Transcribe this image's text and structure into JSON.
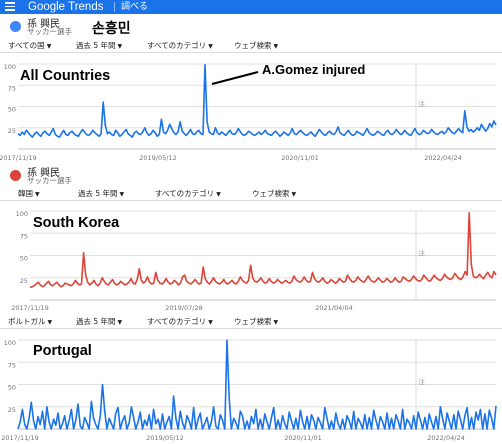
{
  "header": {
    "logo_google": "Google",
    "logo_trends": "Trends",
    "explore_label": "調べる"
  },
  "colors": {
    "blue": "#1a73e8",
    "red": "#db4437",
    "grid": "#e0e0e0"
  },
  "panels": [
    {
      "term": {
        "name": "孫 興民",
        "subtitle": "サッカー選手",
        "korean": "손흥민",
        "color": "#4285f4"
      },
      "filters": [
        "すべての国",
        "過去 5 年間",
        "すべてのカテゴリ",
        "ウェブ検索"
      ],
      "region_label": "All Countries",
      "annotation": "A.Gomez injured"
    },
    {
      "term": {
        "name": "孫 興民",
        "subtitle": "サッカー選手",
        "color": "#db4437"
      },
      "filters": [
        "韓国",
        "過去 5 年間",
        "すべてのカテゴリ",
        "ウェブ検索"
      ],
      "region_label": "South Korea"
    },
    {
      "filters": [
        "ポルトガル",
        "過去 5 年間",
        "すべてのカテゴリ",
        "ウェブ検索"
      ],
      "region_label": "Portugal"
    }
  ],
  "chart_data": [
    {
      "type": "line",
      "title": "All Countries",
      "ylim": [
        0,
        100
      ],
      "yticks": [
        25,
        50,
        75,
        100
      ],
      "x_ticks": [
        "2017/11/19",
        "2019/05/12",
        "2020/11/01",
        "2022/04/24"
      ],
      "note_label": "注",
      "grid": true,
      "series": [
        {
          "color": "#1a73e8",
          "values": [
            18,
            16,
            20,
            17,
            22,
            19,
            16,
            14,
            18,
            20,
            17,
            15,
            19,
            21,
            18,
            16,
            20,
            24,
            17,
            15,
            14,
            18,
            22,
            17,
            16,
            19,
            21,
            18,
            16,
            15,
            19,
            23,
            20,
            17,
            16,
            18,
            22,
            19,
            17,
            15,
            18,
            55,
            28,
            18,
            20,
            17,
            16,
            22,
            19,
            15,
            17,
            20,
            23,
            18,
            16,
            14,
            19,
            21,
            18,
            17,
            20,
            25,
            19,
            16,
            18,
            22,
            19,
            15,
            17,
            35,
            20,
            18,
            22,
            29,
            24,
            19,
            17,
            20,
            32,
            21,
            18,
            16,
            19,
            23,
            18,
            17,
            20,
            22,
            18,
            17,
            99,
            32,
            20,
            18,
            17,
            25,
            19,
            17,
            20,
            18,
            16,
            19,
            22,
            18,
            17,
            19,
            24,
            20,
            17,
            16,
            18,
            21,
            19,
            17,
            16,
            18,
            20,
            17,
            19,
            22,
            18,
            17,
            16,
            19,
            21,
            18,
            15,
            17,
            20,
            18,
            16,
            19,
            24,
            18,
            17,
            20,
            22,
            19,
            17,
            16,
            18,
            20,
            17,
            15,
            19,
            23,
            20,
            17,
            16,
            19,
            21,
            18,
            17,
            20,
            26,
            19,
            17,
            16,
            19,
            22,
            18,
            16,
            17,
            21,
            19,
            18,
            16,
            20,
            24,
            19,
            17,
            16,
            18,
            21,
            19,
            17,
            16,
            20,
            22,
            18,
            17,
            19,
            23,
            20,
            17,
            18,
            22,
            19,
            17,
            16,
            20,
            24,
            19,
            17,
            18,
            22,
            20,
            18,
            19,
            23,
            20,
            18,
            17,
            19,
            21,
            18,
            20,
            25,
            22,
            19,
            18,
            21,
            24,
            21,
            19,
            45,
            26,
            21,
            23,
            20,
            22,
            25,
            22,
            29,
            25,
            21,
            24,
            30,
            26,
            33,
            28
          ]
        }
      ]
    },
    {
      "type": "line",
      "title": "South Korea",
      "ylim": [
        0,
        100
      ],
      "yticks": [
        25,
        50,
        75,
        100
      ],
      "x_ticks": [
        "2017/11/19",
        "2019/07/28",
        "2021/04/04"
      ],
      "note_label": "注",
      "grid": true,
      "series": [
        {
          "color": "#db4437",
          "values": [
            14,
            15,
            16,
            18,
            20,
            17,
            15,
            16,
            19,
            21,
            17,
            16,
            18,
            20,
            17,
            15,
            16,
            19,
            18,
            17,
            16,
            18,
            22,
            19,
            17,
            18,
            53,
            28,
            20,
            17,
            19,
            22,
            18,
            16,
            19,
            25,
            21,
            18,
            17,
            20,
            23,
            19,
            17,
            18,
            21,
            19,
            17,
            18,
            20,
            24,
            19,
            18,
            23,
            35,
            22,
            19,
            21,
            26,
            20,
            18,
            19,
            31,
            22,
            19,
            18,
            20,
            24,
            20,
            18,
            19,
            22,
            20,
            17,
            19,
            26,
            28,
            21,
            19,
            18,
            20,
            23,
            20,
            18,
            19,
            37,
            24,
            20,
            18,
            21,
            25,
            21,
            19,
            18,
            20,
            23,
            19,
            18,
            20,
            22,
            19,
            18,
            21,
            26,
            22,
            20,
            19,
            22,
            39,
            25,
            21,
            20,
            22,
            25,
            21,
            19,
            20,
            24,
            21,
            19,
            20,
            23,
            21,
            19,
            20,
            22,
            20,
            19,
            21,
            27,
            23,
            21,
            20,
            22,
            26,
            22,
            20,
            21,
            31,
            24,
            21,
            20,
            22,
            25,
            21,
            19,
            20,
            23,
            21,
            19,
            20,
            24,
            22,
            20,
            21,
            28,
            24,
            21,
            20,
            22,
            26,
            23,
            21,
            20,
            23,
            27,
            23,
            21,
            20,
            22,
            25,
            22,
            20,
            21,
            24,
            22,
            20,
            21,
            25,
            22,
            20,
            21,
            26,
            24,
            22,
            21,
            23,
            27,
            24,
            22,
            21,
            23,
            28,
            25,
            22,
            21,
            24,
            28,
            25,
            23,
            22,
            24,
            29,
            26,
            24,
            23,
            25,
            30,
            27,
            24,
            23,
            26,
            32,
            28,
            98,
            40,
            27,
            25,
            26,
            29,
            26,
            24,
            28,
            31,
            27,
            25,
            32,
            28
          ]
        }
      ]
    },
    {
      "type": "line",
      "title": "Portugal",
      "ylim": [
        0,
        100
      ],
      "yticks": [
        25,
        50,
        75,
        100
      ],
      "x_ticks": [
        "2017/11/19",
        "2019/05/12",
        "2020/11/01",
        "2022/04/24"
      ],
      "note_label": "注",
      "grid": true,
      "series": [
        {
          "color": "#1a73e8",
          "values": [
            0,
            8,
            22,
            5,
            0,
            12,
            30,
            9,
            0,
            14,
            5,
            20,
            0,
            25,
            8,
            0,
            11,
            4,
            18,
            0,
            6,
            15,
            0,
            9,
            22,
            0,
            10,
            28,
            3,
            0,
            13,
            7,
            0,
            31,
            12,
            5,
            0,
            15,
            50,
            20,
            0,
            12,
            6,
            0,
            18,
            24,
            0,
            9,
            15,
            0,
            7,
            25,
            13,
            0,
            8,
            19,
            0,
            10,
            4,
            16,
            0,
            22,
            6,
            11,
            0,
            17,
            0,
            8,
            14,
            0,
            37,
            12,
            0,
            20,
            7,
            0,
            15,
            9,
            0,
            24,
            0,
            11,
            18,
            0,
            6,
            13,
            0,
            8,
            25,
            3,
            0,
            16,
            10,
            0,
            100,
            35,
            0,
            12,
            7,
            0,
            20,
            15,
            0,
            9,
            0,
            14,
            6,
            22,
            0,
            11,
            0,
            17,
            8,
            0,
            13,
            24,
            0,
            10,
            0,
            15,
            6,
            0,
            19,
            9,
            0,
            12,
            0,
            21,
            8,
            0,
            14,
            0,
            16,
            10,
            0,
            13,
            7,
            0,
            24,
            12,
            0,
            9,
            0,
            18,
            6,
            0,
            11,
            0,
            15,
            9,
            0,
            20,
            0,
            12,
            7,
            0,
            16,
            0,
            13,
            0,
            21,
            10,
            0,
            14,
            8,
            0,
            18,
            0,
            12,
            0,
            16,
            9,
            0,
            22,
            0,
            11,
            7,
            0,
            15,
            0,
            19,
            10,
            0,
            13,
            0,
            17,
            8,
            0,
            14,
            0,
            25,
            12,
            0,
            18,
            9,
            0,
            16,
            0,
            20,
            11,
            0,
            15,
            24,
            0,
            13,
            0,
            19,
            10,
            22,
            0,
            17,
            0,
            21,
            12,
            0,
            26
          ]
        }
      ]
    }
  ]
}
